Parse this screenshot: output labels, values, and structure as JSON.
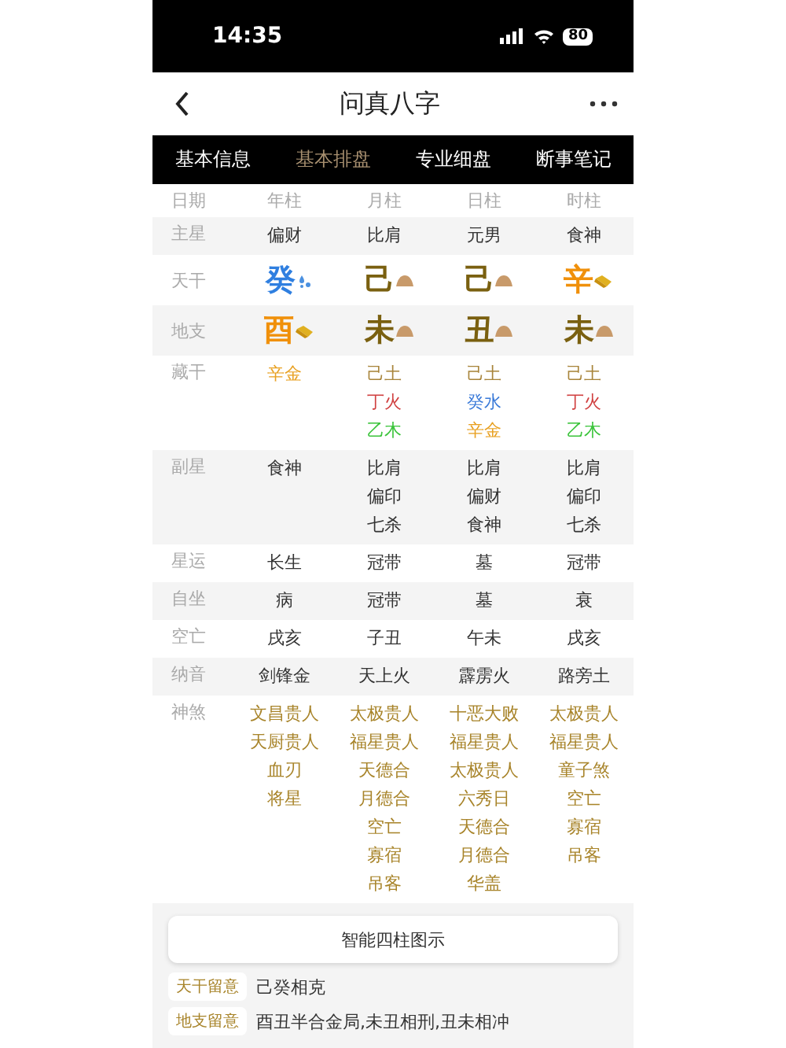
{
  "status_bar": {
    "time": "14:35",
    "battery": "80"
  },
  "nav": {
    "title": "问真八字"
  },
  "tabs": [
    {
      "label": "基本信息",
      "selected": false
    },
    {
      "label": "基本排盘",
      "selected": true
    },
    {
      "label": "专业细盘",
      "selected": false
    },
    {
      "label": "断事笔记",
      "selected": false
    }
  ],
  "header": {
    "label": "日期",
    "columns": [
      "年柱",
      "月柱",
      "日柱",
      "时柱"
    ]
  },
  "rows": [
    {
      "kind": "text",
      "label": "主星",
      "cells": [
        [
          "偏财"
        ],
        [
          "比肩"
        ],
        [
          "元男"
        ],
        [
          "食神"
        ]
      ]
    },
    {
      "kind": "glyph",
      "label": "天干",
      "cells": [
        {
          "char": "癸",
          "color": "#2f7fe0",
          "kind": "water"
        },
        {
          "char": "己",
          "color": "#7a6010",
          "kind": "earth"
        },
        {
          "char": "己",
          "color": "#7a6010",
          "kind": "earth"
        },
        {
          "char": "辛",
          "color": "#f0900a",
          "kind": "metal"
        }
      ]
    },
    {
      "kind": "glyph",
      "label": "地支",
      "cells": [
        {
          "char": "酉",
          "color": "#f0900a",
          "kind": "metal"
        },
        {
          "char": "未",
          "color": "#7a6010",
          "kind": "earth"
        },
        {
          "char": "丑",
          "color": "#7a6010",
          "kind": "earth"
        },
        {
          "char": "未",
          "color": "#7a6010",
          "kind": "earth"
        }
      ]
    },
    {
      "kind": "colored",
      "label": "藏干",
      "cells": [
        [
          {
            "text": "辛金",
            "color": "#e8a020"
          }
        ],
        [
          {
            "text": "己土",
            "color": "#a8843a"
          },
          {
            "text": "丁火",
            "color": "#d04040"
          },
          {
            "text": "乙木",
            "color": "#3cc43c"
          }
        ],
        [
          {
            "text": "己土",
            "color": "#a8843a"
          },
          {
            "text": "癸水",
            "color": "#3a7ad8"
          },
          {
            "text": "辛金",
            "color": "#e8a020"
          }
        ],
        [
          {
            "text": "己土",
            "color": "#a8843a"
          },
          {
            "text": "丁火",
            "color": "#d04040"
          },
          {
            "text": "乙木",
            "color": "#3cc43c"
          }
        ]
      ]
    },
    {
      "kind": "text",
      "label": "副星",
      "cells": [
        [
          "食神"
        ],
        [
          "比肩",
          "偏印",
          "七杀"
        ],
        [
          "比肩",
          "偏财",
          "食神"
        ],
        [
          "比肩",
          "偏印",
          "七杀"
        ]
      ]
    },
    {
      "kind": "text",
      "label": "星运",
      "cells": [
        [
          "长生"
        ],
        [
          "冠带"
        ],
        [
          "墓"
        ],
        [
          "冠带"
        ]
      ]
    },
    {
      "kind": "text",
      "label": "自坐",
      "cells": [
        [
          "病"
        ],
        [
          "冠带"
        ],
        [
          "墓"
        ],
        [
          "衰"
        ]
      ]
    },
    {
      "kind": "text",
      "label": "空亡",
      "cells": [
        [
          "戌亥"
        ],
        [
          "子丑"
        ],
        [
          "午未"
        ],
        [
          "戌亥"
        ]
      ]
    },
    {
      "kind": "text",
      "label": "纳音",
      "cells": [
        [
          "剑锋金"
        ],
        [
          "天上火"
        ],
        [
          "霹雳火"
        ],
        [
          "路旁土"
        ]
      ]
    },
    {
      "kind": "gold",
      "label": "神煞",
      "cells": [
        [
          "文昌贵人",
          "天厨贵人",
          "血刃",
          "将星"
        ],
        [
          "太极贵人",
          "福星贵人",
          "天德合",
          "月德合",
          "空亡",
          "寡宿",
          "吊客"
        ],
        [
          "十恶大败",
          "福星贵人",
          "太极贵人",
          "六秀日",
          "天德合",
          "月德合",
          "华盖"
        ],
        [
          "太极贵人",
          "福星贵人",
          "童子煞",
          "空亡",
          "寡宿",
          "吊客"
        ]
      ]
    }
  ],
  "diagram_button": "智能四柱图示",
  "notes": [
    {
      "tag": "天干留意",
      "text": "己癸相克"
    },
    {
      "tag": "地支留意",
      "text": "酉丑半合金局,未丑相刑,丑未相冲"
    }
  ]
}
